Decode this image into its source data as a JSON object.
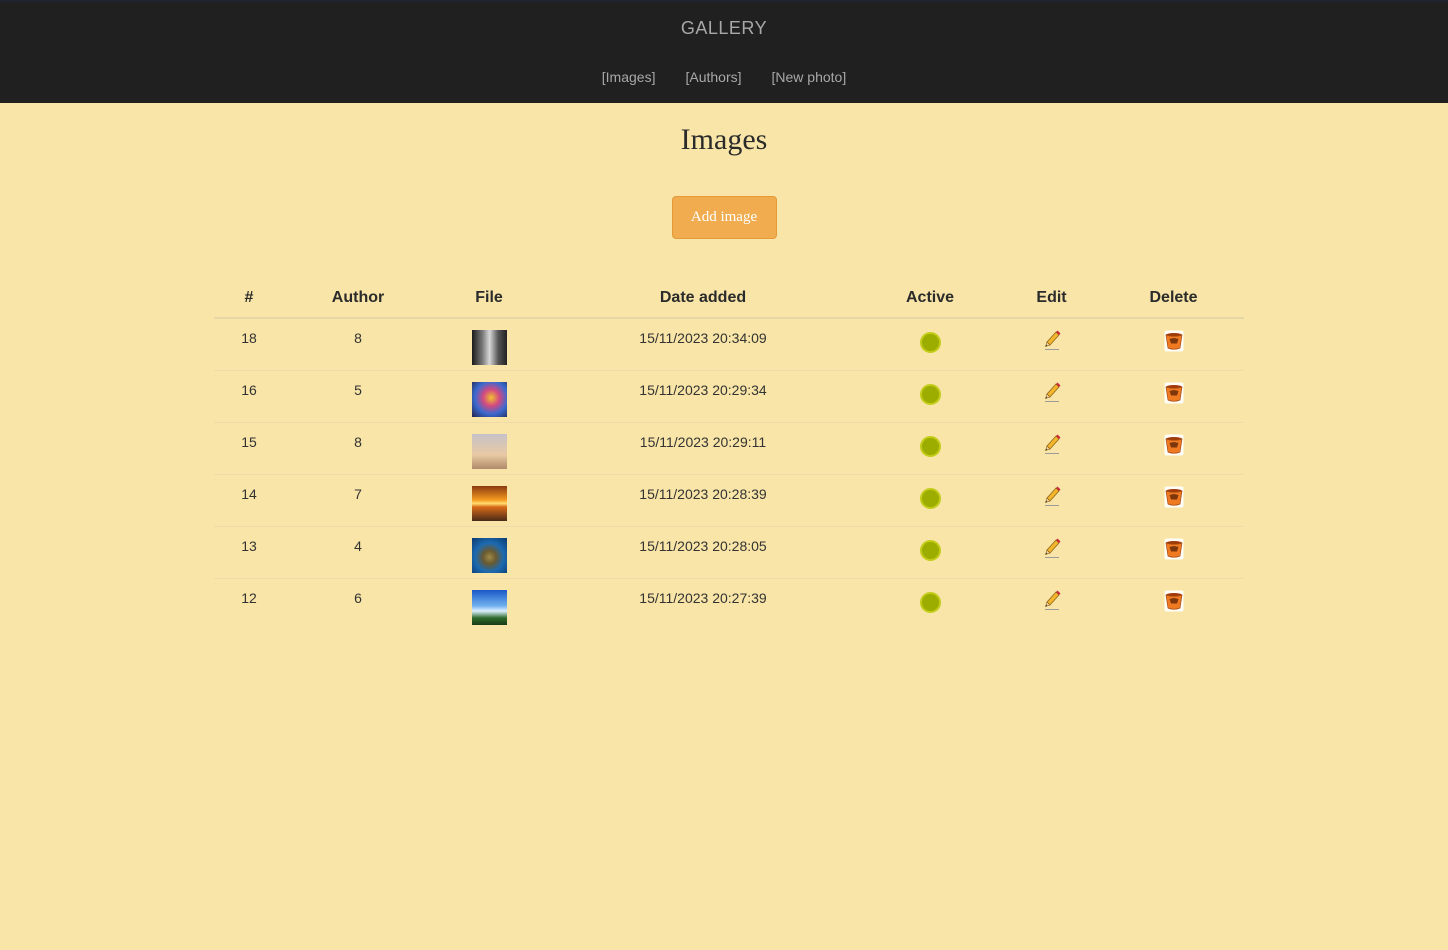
{
  "header": {
    "brand": "GALLERY",
    "nav": [
      {
        "label": "[Images]"
      },
      {
        "label": "[Authors]"
      },
      {
        "label": "[New photo]"
      }
    ]
  },
  "main": {
    "title": "Images",
    "add_button": "Add image",
    "table": {
      "headers": [
        "#",
        "Author",
        "File",
        "Date added",
        "Active",
        "Edit",
        "Delete"
      ],
      "rows": [
        {
          "id": "18",
          "author": "8",
          "thumb": "bw-portrait",
          "date": "15/11/2023 20:34:09",
          "active": true
        },
        {
          "id": "16",
          "author": "5",
          "thumb": "colorful-balloon",
          "date": "15/11/2023 20:29:34",
          "active": true
        },
        {
          "id": "15",
          "author": "8",
          "thumb": "airplane-sky",
          "date": "15/11/2023 20:29:11",
          "active": true
        },
        {
          "id": "14",
          "author": "7",
          "thumb": "sunset-sea",
          "date": "15/11/2023 20:28:39",
          "active": true
        },
        {
          "id": "13",
          "author": "4",
          "thumb": "sea-turtle",
          "date": "15/11/2023 20:28:05",
          "active": true
        },
        {
          "id": "12",
          "author": "6",
          "thumb": "blue-sky-landscape",
          "date": "15/11/2023 20:27:39",
          "active": true
        }
      ]
    },
    "icons": {
      "active": "active-status-icon",
      "edit": "pencil-icon",
      "delete": "trash-icon"
    },
    "colors": {
      "background": "#f8e5a7",
      "header": "#202020",
      "button": "#f0ac4f",
      "active_dot": "#9cad00"
    }
  }
}
